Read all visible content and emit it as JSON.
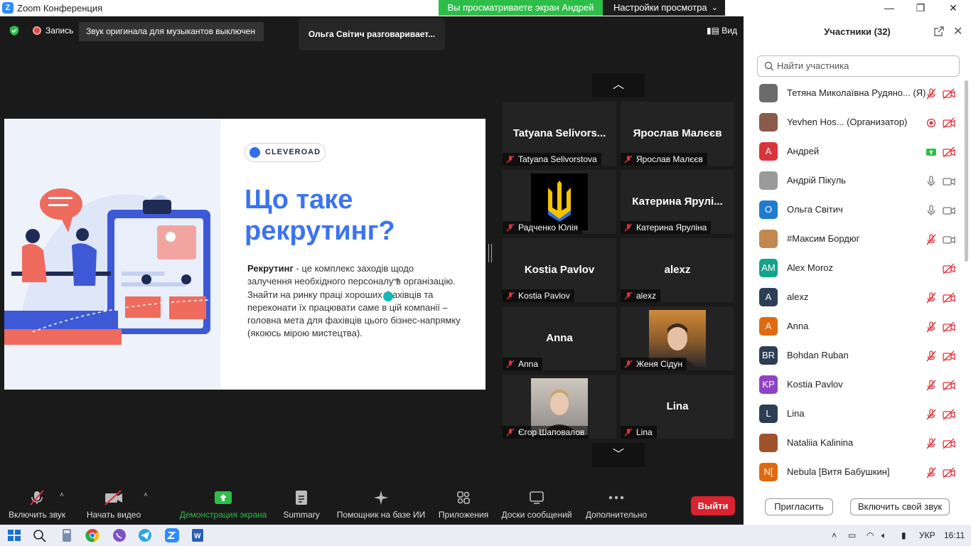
{
  "titlebar": {
    "app_icon": "Z",
    "title": "Zoom Конференция"
  },
  "share": {
    "banner": "Вы просматриваете экран Андрей",
    "view_settings": "Настройки просмотра"
  },
  "window_controls": {
    "minimize": "—",
    "maximize": "❐",
    "close": "✕"
  },
  "meeting": {
    "record_label": "Запись",
    "original_sound": "Звук оригинала для музыкантов выключен",
    "talking": "Ольга Світич разговаривает...",
    "view_label": "Вид"
  },
  "slide": {
    "logo": "CLEVEROAD",
    "title": "Що таке рекрутинг?",
    "body_bold": "Рекрутинг",
    "body_text": " - це комплекс заходів щодо залучення необхідного персоналу в організацію. Знайти на ринку праці хороших фахівців та переконати їх працювати саме в цій компанії – головна мета для фахівців цього бізнес-напрямку (якоюсь мірою мистецтва)."
  },
  "tiles": [
    {
      "big": "Tatyana  Selivors...",
      "label": "Tatyana Selivorstova"
    },
    {
      "big": "Ярослав Малєєв",
      "label": "Ярослав Малєєв"
    },
    {
      "big": "",
      "label": "Радченко Юлія"
    },
    {
      "big": "Катерина  Ярулі...",
      "label": "Катерина Яруліна"
    },
    {
      "big": "Kostia Pavlov",
      "label": "Kostia Pavlov"
    },
    {
      "big": "alexz",
      "label": "alexz"
    },
    {
      "big": "Anna",
      "label": "Anna"
    },
    {
      "big": "",
      "label": "Женя Сідун"
    },
    {
      "big": "",
      "label": "Єгор Шаповалов"
    },
    {
      "big": "Lina",
      "label": "Lina"
    }
  ],
  "toolbar": {
    "mute": "Включить звук",
    "video": "Начать видео",
    "share": "Демонстрация экрана",
    "summary": "Summary",
    "ai": "Помощник на базе ИИ",
    "apps": "Приложения",
    "boards": "Доски сообщений",
    "more": "Дополнительно",
    "exit": "Выйти"
  },
  "panel": {
    "title": "Участники (32)",
    "search_placeholder": "Найти участника",
    "invite": "Пригласить",
    "unmute_self": "Включить свой звук",
    "participants": [
      {
        "initials": "",
        "name": "Тетяна Миколаївна Рудяно... (Я)",
        "color": "#6b6b6b",
        "mic": "off",
        "video": "off"
      },
      {
        "initials": "",
        "name": "Yevhen Hos... (Организатор)",
        "color": "#8a5a4a",
        "mic": "rec",
        "video": "off"
      },
      {
        "initials": "А",
        "name": "Андрей",
        "color": "#d9343a",
        "mic": "share",
        "video": "off"
      },
      {
        "initials": "",
        "name": "Андрій Пікуль",
        "color": "#9a9a9a",
        "mic": "on",
        "video": "on"
      },
      {
        "initials": "О",
        "name": "Ольга Світич",
        "color": "#1f7ad1",
        "mic": "on",
        "video": "on"
      },
      {
        "initials": "",
        "name": "#Максим Бордюг",
        "color": "#c2884e",
        "mic": "off",
        "video": "on"
      },
      {
        "initials": "AM",
        "name": "Alex Moroz",
        "color": "#14a38b",
        "mic": "none",
        "video": "off"
      },
      {
        "initials": "A",
        "name": "alexz",
        "color": "#2c3e55",
        "mic": "off",
        "video": "off"
      },
      {
        "initials": "A",
        "name": "Anna",
        "color": "#e06a10",
        "mic": "off",
        "video": "off"
      },
      {
        "initials": "BR",
        "name": "Bohdan Ruban",
        "color": "#2c3e55",
        "mic": "off",
        "video": "off"
      },
      {
        "initials": "KP",
        "name": "Kostia Pavlov",
        "color": "#8e44c2",
        "mic": "off",
        "video": "off"
      },
      {
        "initials": "L",
        "name": "Lina",
        "color": "#2c3e55",
        "mic": "off",
        "video": "off"
      },
      {
        "initials": "",
        "name": "Nataliia Kalinina",
        "color": "#a0522d",
        "mic": "off",
        "video": "off"
      },
      {
        "initials": "N[",
        "name": "Nebula [Витя Бабушкин]",
        "color": "#e06a10",
        "mic": "off",
        "video": "off"
      }
    ]
  },
  "taskbar": {
    "lang": "УКР",
    "time": "16:11"
  },
  "colors": {
    "zoom_blue": "#2d8cff",
    "share_green": "#2fbd4a",
    "mute_red": "#e0303a",
    "exit_red": "#d9232e"
  }
}
